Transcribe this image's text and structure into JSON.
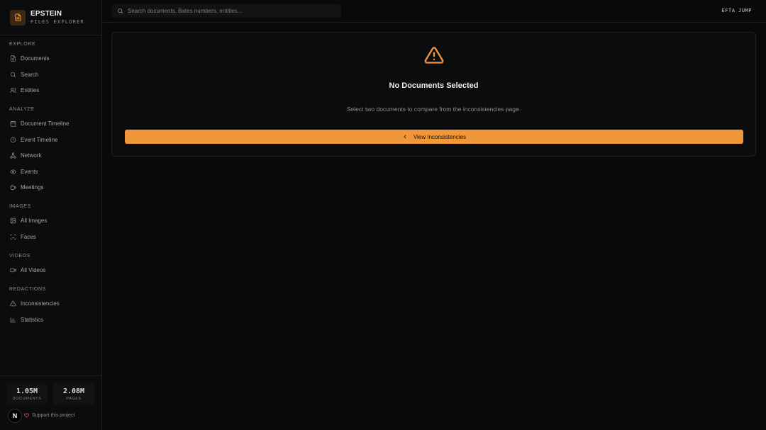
{
  "brand": {
    "title": "EPSTEIN",
    "subtitle": "FILES EXPLORER"
  },
  "sidebar": {
    "sections": [
      {
        "heading": "EXPLORE",
        "items": [
          {
            "label": "Documents",
            "icon": "document-icon"
          },
          {
            "label": "Search",
            "icon": "search-icon"
          },
          {
            "label": "Entities",
            "icon": "users-icon"
          }
        ]
      },
      {
        "heading": "ANALYZE",
        "items": [
          {
            "label": "Document Timeline",
            "icon": "calendar-icon"
          },
          {
            "label": "Event Timeline",
            "icon": "clock-icon"
          },
          {
            "label": "Network",
            "icon": "network-icon"
          },
          {
            "label": "Events",
            "icon": "eye-icon"
          },
          {
            "label": "Meetings",
            "icon": "coffee-icon"
          }
        ]
      },
      {
        "heading": "IMAGES",
        "items": [
          {
            "label": "All Images",
            "icon": "image-icon"
          },
          {
            "label": "Faces",
            "icon": "face-scan-icon"
          }
        ]
      },
      {
        "heading": "VIDEOS",
        "items": [
          {
            "label": "All Videos",
            "icon": "video-icon"
          }
        ]
      },
      {
        "heading": "REDACTIONS",
        "items": [
          {
            "label": "Inconsistencies",
            "icon": "warning-icon"
          },
          {
            "label": "Statistics",
            "icon": "bar-chart-icon"
          }
        ]
      }
    ]
  },
  "stats": {
    "documents_value": "1.05M",
    "documents_label": "DOCUMENTS",
    "pages_value": "2.08M",
    "pages_label": "PAGES"
  },
  "footer": {
    "badge": "N",
    "support_label": "Support this project"
  },
  "topbar": {
    "search_placeholder": "Search documents, Bates numbers, entities...",
    "efta_label": "EFTA JUMP"
  },
  "main": {
    "title": "No Documents Selected",
    "message": "Select two documents to compare from the inconsistencies page.",
    "button_label": "View Inconsistencies"
  },
  "colors": {
    "accent": "#f0973a",
    "background": "#08090a"
  }
}
